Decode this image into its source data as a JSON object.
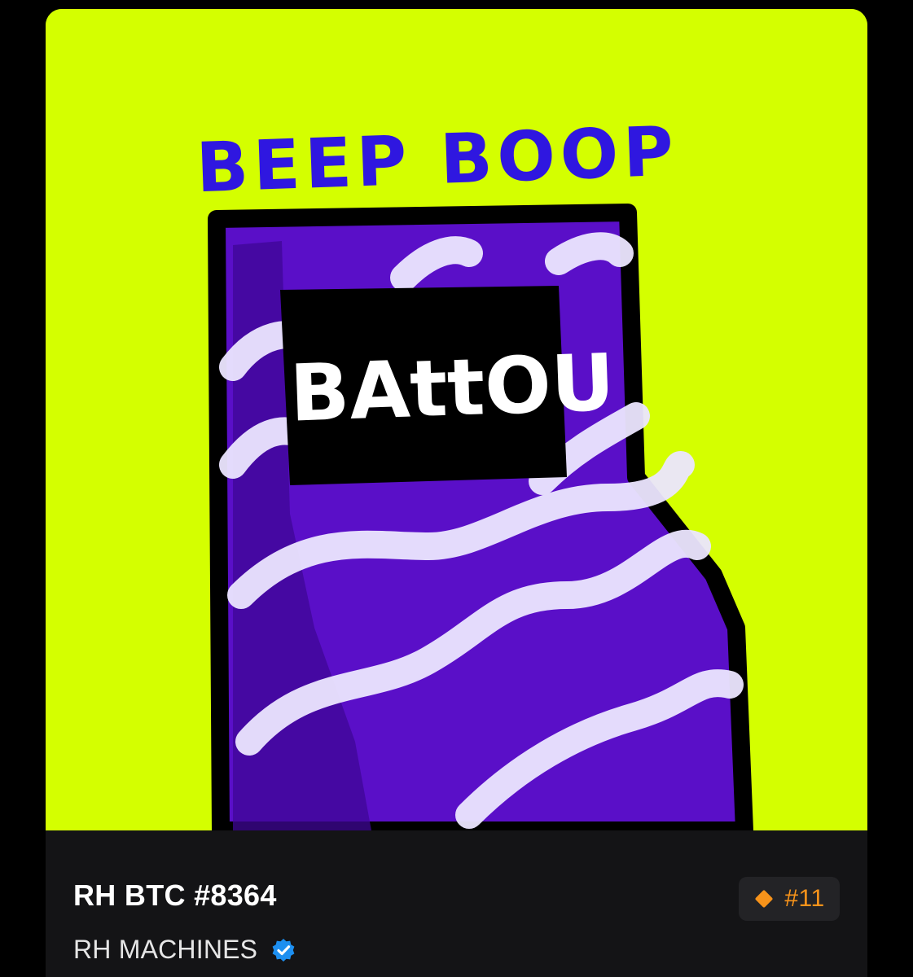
{
  "card": {
    "artwork": {
      "text_top": "BEEP BOOP",
      "text_label": "BAttOU",
      "background_color": "#d4ff00",
      "body_color": "#5a0fc8",
      "wave_color": "#ece6ff"
    },
    "title": "RH BTC #8364",
    "collection": {
      "name": "RH MACHINES",
      "verified_icon": "verified-badge-icon"
    },
    "rank": {
      "icon": "diamond-icon",
      "value": "#11",
      "color": "#f7931a"
    }
  }
}
